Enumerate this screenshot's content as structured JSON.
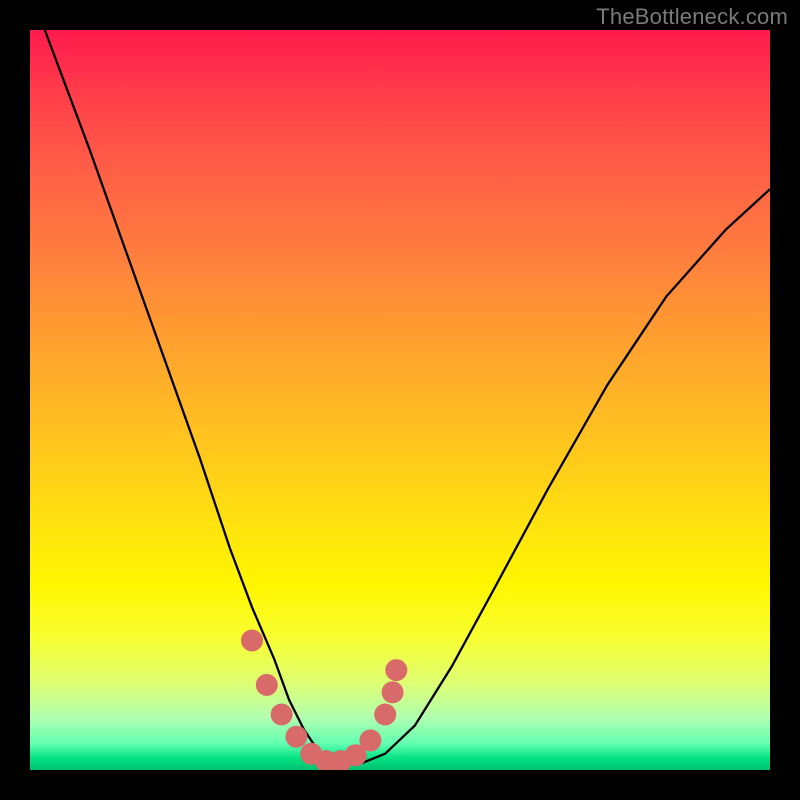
{
  "watermark": "TheBottleneck.com",
  "chart_data": {
    "type": "line",
    "title": "",
    "xlabel": "",
    "ylabel": "",
    "xlim": [
      0,
      1
    ],
    "ylim": [
      0,
      1
    ],
    "series": [
      {
        "name": "bottleneck-curve",
        "x": [
          0.02,
          0.08,
          0.13,
          0.18,
          0.23,
          0.27,
          0.3,
          0.33,
          0.35,
          0.37,
          0.39,
          0.42,
          0.45,
          0.48,
          0.52,
          0.57,
          0.63,
          0.7,
          0.78,
          0.86,
          0.94,
          1.0
        ],
        "y": [
          1.0,
          0.84,
          0.7,
          0.56,
          0.42,
          0.3,
          0.22,
          0.15,
          0.095,
          0.055,
          0.025,
          0.01,
          0.01,
          0.022,
          0.06,
          0.14,
          0.25,
          0.38,
          0.52,
          0.64,
          0.73,
          0.785
        ]
      }
    ],
    "highlight_points": {
      "name": "markers",
      "x": [
        0.3,
        0.32,
        0.34,
        0.36,
        0.38,
        0.4,
        0.42,
        0.44,
        0.46,
        0.48,
        0.49,
        0.495
      ],
      "y": [
        0.175,
        0.115,
        0.075,
        0.045,
        0.022,
        0.012,
        0.012,
        0.02,
        0.04,
        0.075,
        0.105,
        0.135
      ]
    },
    "colors": {
      "curve": "#000000",
      "markers": "#d86a6a",
      "gradient_top": "#ff1a4d",
      "gradient_mid": "#fff600",
      "gradient_bottom": "#00c070"
    }
  }
}
